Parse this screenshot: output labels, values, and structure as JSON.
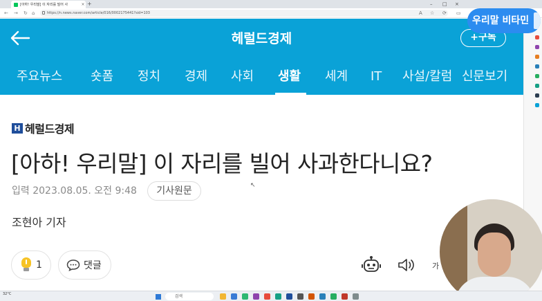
{
  "browser": {
    "tab_title": "[아하! 우리말] 이 자리를 빌어 사",
    "tab_close": "×",
    "new_tab": "+",
    "url": "https://n.news.naver.com/article/016/0002175441?sid=103",
    "window_controls": [
      "–",
      "□",
      "×"
    ]
  },
  "header": {
    "back_label": "←",
    "brand": "헤럴드경제",
    "subscribe_label": "+구독"
  },
  "categories": [
    "주요뉴스",
    "숏폼",
    "정치",
    "경제",
    "사회",
    "생활",
    "세계",
    "IT",
    "사설/칼럼",
    "신문보기"
  ],
  "active_category": "생활",
  "article": {
    "press_mark": "H",
    "press_name": "헤럴드경제",
    "headline": "[아하! 우리말] 이 자리를 빌어 사과한다니요?",
    "date_label": "입력",
    "date_value": "2023.08.05. 오전 9:48",
    "original_button": "기사원문",
    "reporter": "조현아 기자",
    "reaction_count": "1",
    "comment_label": "댓글",
    "font_size_label": "가"
  },
  "overlay": {
    "channel_badge": "우리말 비타민"
  },
  "taskbar": {
    "weather": "32°C",
    "search_label": "검색"
  },
  "colors": {
    "naver_blue": "#0aa2d7",
    "badge_blue": "#2c8cf0",
    "bulb_yellow": "#f7c325"
  }
}
